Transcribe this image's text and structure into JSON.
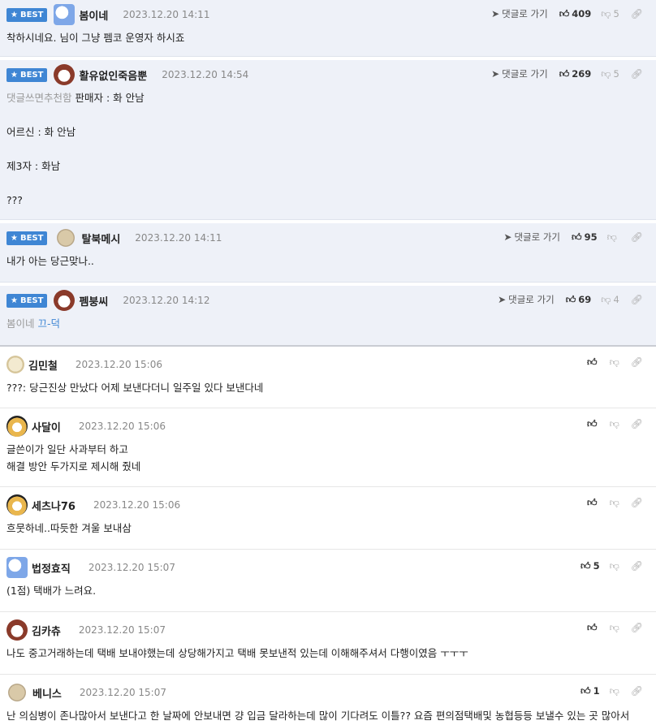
{
  "labels": {
    "best": "BEST",
    "goto": "댓글로 가기"
  },
  "best_comments": [
    {
      "nick": "봄이네",
      "date": "2023.12.20 14:11",
      "up": "409",
      "down": "5",
      "lines": [
        "착하시네요. 님이 그냥 펨코 운영자 하시죠"
      ]
    },
    {
      "nick": "활유없인죽음뿐",
      "date": "2023.12.20 14:54",
      "up": "269",
      "down": "5",
      "prefix": "댓글쓰면추천함",
      "lines": [
        "판매자 : 화 안남",
        "어르신 : 화 안남",
        "제3자 : 화남",
        "???"
      ]
    },
    {
      "nick": "탈북메시",
      "date": "2023.12.20 14:11",
      "up": "95",
      "down": "",
      "lines": [
        "내가 아는 당근맞나.."
      ]
    },
    {
      "nick": "펨붕씨",
      "date": "2023.12.20 14:12",
      "up": "69",
      "down": "4",
      "mention": "봄이네",
      "mention_text": "끄-덕",
      "lines": []
    }
  ],
  "comments": [
    {
      "nick": "김민철",
      "date": "2023.12.20 15:06",
      "up": "",
      "lines": [
        "???: 당근진상 만났다 어제 보낸다더니 일주일 있다 보낸다네"
      ]
    },
    {
      "nick": "사달이",
      "date": "2023.12.20 15:06",
      "up": "",
      "lines": [
        "글쓴이가 일단 사과부터 하고",
        "해결 방안 두가지로 제시해 줬네"
      ]
    },
    {
      "nick": "세츠나76",
      "date": "2023.12.20 15:06",
      "up": "",
      "lines": [
        "흐뭇하네..따듯한 겨울 보내삼"
      ]
    },
    {
      "nick": "법정효직",
      "date": "2023.12.20 15:07",
      "up": "5",
      "lines": [
        "(1점) 택배가 느려요."
      ]
    },
    {
      "nick": "김카츄",
      "date": "2023.12.20 15:07",
      "up": "",
      "lines": [
        "나도 중고거래하는데 택배 보내야했는데 상당해가지고 택배 못보낸적 있는데 이해해주셔서 다행이였음 ㅜㅜㅜ"
      ]
    },
    {
      "nick": "베니스",
      "date": "2023.12.20 15:07",
      "up": "1",
      "lines": [
        "난 의심병이 존나많아서 보낸다고 한 날짜에 안보내면 걍 입금 달라하는데 많이 기다려도 이틀?? 요즘 편의점택배및 농협등등 보낼수 있는 곳 많아서"
      ]
    }
  ],
  "icons": {
    "thumb_up": "thumbs-up-icon",
    "thumb_down": "thumbs-down-icon",
    "link": "link-icon",
    "goto": "arrow-icon",
    "star": "star-icon"
  },
  "colors": {
    "best_bg": "#eef1f8",
    "badge": "#3f86d4",
    "link": "#3f86d4"
  }
}
